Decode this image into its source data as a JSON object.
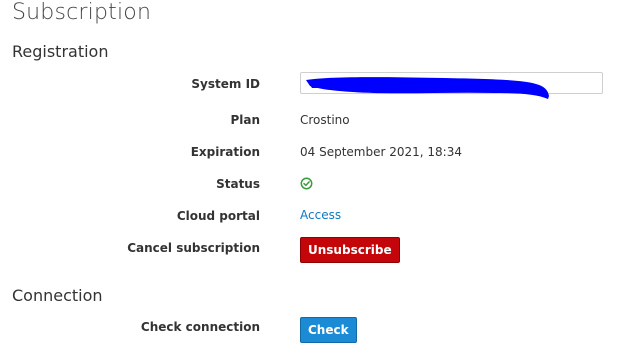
{
  "page": {
    "title": "Subscription"
  },
  "registration": {
    "heading": "Registration",
    "system_id": {
      "label": "System ID",
      "value": ""
    },
    "plan": {
      "label": "Plan",
      "value": "Crostino"
    },
    "expiration": {
      "label": "Expiration",
      "value": "04 September 2021, 18:34"
    },
    "status": {
      "label": "Status",
      "icon": "check-circle-icon",
      "color": "#3c9b3c"
    },
    "cloud_portal": {
      "label": "Cloud portal",
      "link_text": "Access",
      "link_color": "#0b7ac0"
    },
    "cancel_subscription": {
      "label": "Cancel subscription",
      "button_label": "Unsubscribe",
      "button_color": "#c4060a"
    }
  },
  "connection": {
    "heading": "Connection",
    "check_connection": {
      "label": "Check connection",
      "button_label": "Check",
      "button_color": "#1c8bd6"
    }
  },
  "colors": {
    "redaction": "#0000ff"
  }
}
